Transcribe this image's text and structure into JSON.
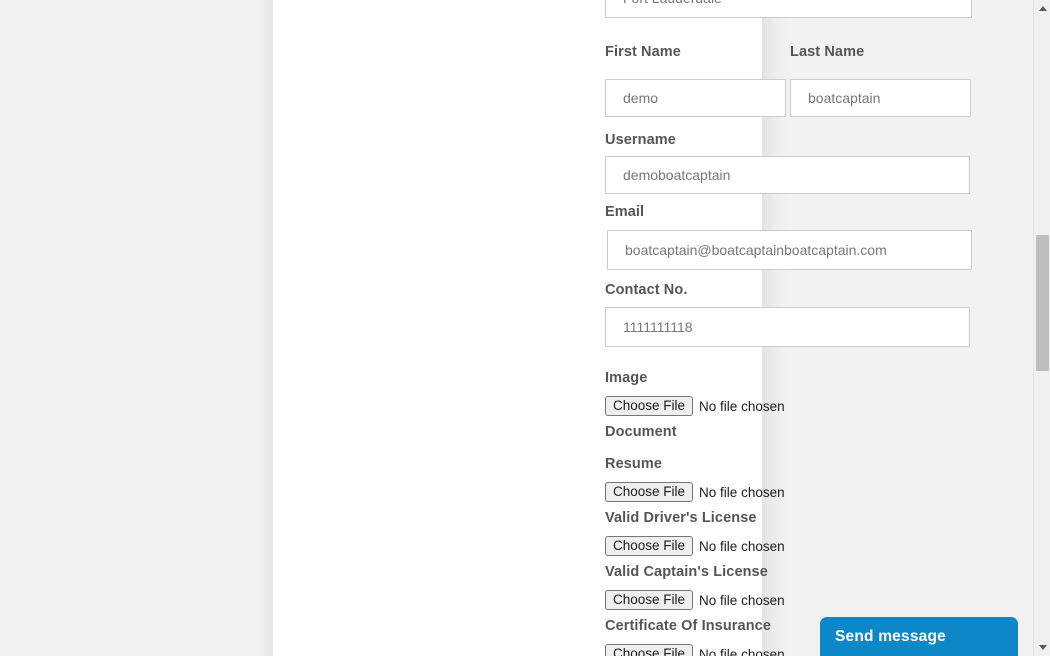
{
  "page": {
    "background_color": "#f2f2f2",
    "card_background": "#ffffff"
  },
  "form": {
    "partial_top_field": {
      "label": "",
      "value": "Fort Lauderdale"
    },
    "first_name": {
      "label": "First Name",
      "value": "demo"
    },
    "last_name": {
      "label": "Last Name",
      "value": "boatcaptain"
    },
    "username": {
      "label": "Username",
      "value": "demoboatcaptain"
    },
    "email": {
      "label": "Email",
      "value": "boatcaptain@boatcaptainboatcaptain.com"
    },
    "contact_no": {
      "label": "Contact No.",
      "value": "1111111118"
    },
    "image": {
      "label": "Image",
      "button_label": "Choose File",
      "status": "No file chosen"
    },
    "document_heading": {
      "label": "Document"
    },
    "resume": {
      "label": "Resume",
      "button_label": "Choose File",
      "status": "No file chosen"
    },
    "drivers_license": {
      "label": "Valid Driver's License",
      "button_label": "Choose File",
      "status": "No file chosen"
    },
    "captains_license": {
      "label": "Valid Captain's License",
      "button_label": "Choose File",
      "status": "No file chosen"
    },
    "certificate_of_insurance": {
      "label": "Certificate Of Insurance",
      "button_label": "Choose File",
      "status": "No file chosen"
    }
  },
  "chat_widget": {
    "label": "Send message",
    "accent_color": "#0e87c8"
  },
  "scrollbar": {
    "up_icon": "caret-up-icon",
    "down_icon": "caret-down-icon",
    "thumb_color": "#bdbdbd"
  }
}
